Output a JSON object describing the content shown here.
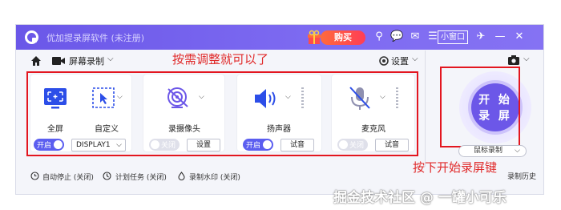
{
  "window": {
    "title": "优加提录屏软件 (未注册)",
    "buy_label": "购买",
    "mini_label": "小窗口"
  },
  "toolbar": {
    "mode_label": "屏幕录制",
    "settings_label": "设置",
    "hint": "按需调整就可以了"
  },
  "cards": [
    {
      "label": "全屏",
      "toggle": "开启",
      "toggle_on": true,
      "select_value": "DISPLAY1"
    },
    {
      "label": "自定义"
    },
    {
      "label": "录摄像头",
      "toggle": "关闭",
      "toggle_on": false,
      "button": "设置"
    },
    {
      "label": "扬声器",
      "toggle": "开启",
      "toggle_on": true,
      "button": "试音"
    },
    {
      "label": "麦克风",
      "toggle": "关闭",
      "toggle_on": false,
      "button": "试音"
    }
  ],
  "status": {
    "auto_stop": "自动停止 (关闭)",
    "schedule": "计划任务 (关闭)",
    "watermark": "录制水印 (关闭)"
  },
  "record": {
    "line1": "开 始",
    "line2": "录 屏",
    "mouse_mode": "鼠标录制",
    "history": "录制历史",
    "hint": "按下开始录屏键"
  },
  "overlay": {
    "watermark": "掘金技术社区 @ 一罐小可乐"
  },
  "colors": {
    "accent": "#6c57e8",
    "highlight": "#e3161f",
    "toggle_on": "#5b5ef0"
  }
}
